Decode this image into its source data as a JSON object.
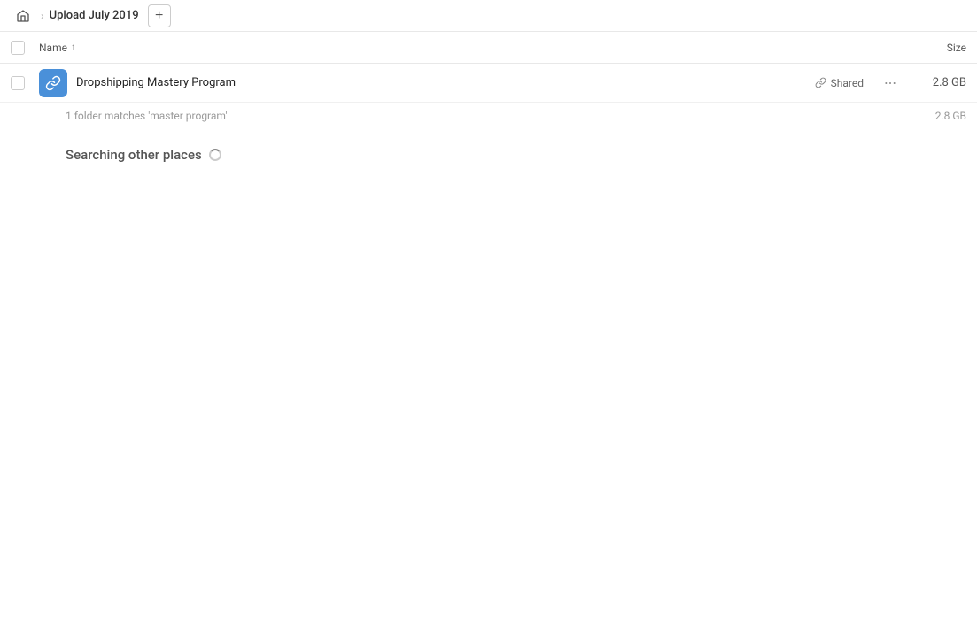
{
  "header": {
    "home_icon": "home",
    "breadcrumb_label": "Upload July 2019",
    "add_button_label": "+"
  },
  "columns": {
    "name_label": "Name",
    "size_label": "Size",
    "sort_arrow": "↑"
  },
  "file_row": {
    "name": "Dropshipping Mastery Program",
    "shared_label": "Shared",
    "more_label": "...",
    "size": "2.8 GB",
    "icon_alt": "shared-folder-icon"
  },
  "summary": {
    "text": "1 folder matches 'master program'",
    "size": "2.8 GB"
  },
  "searching": {
    "label": "Searching other places"
  }
}
